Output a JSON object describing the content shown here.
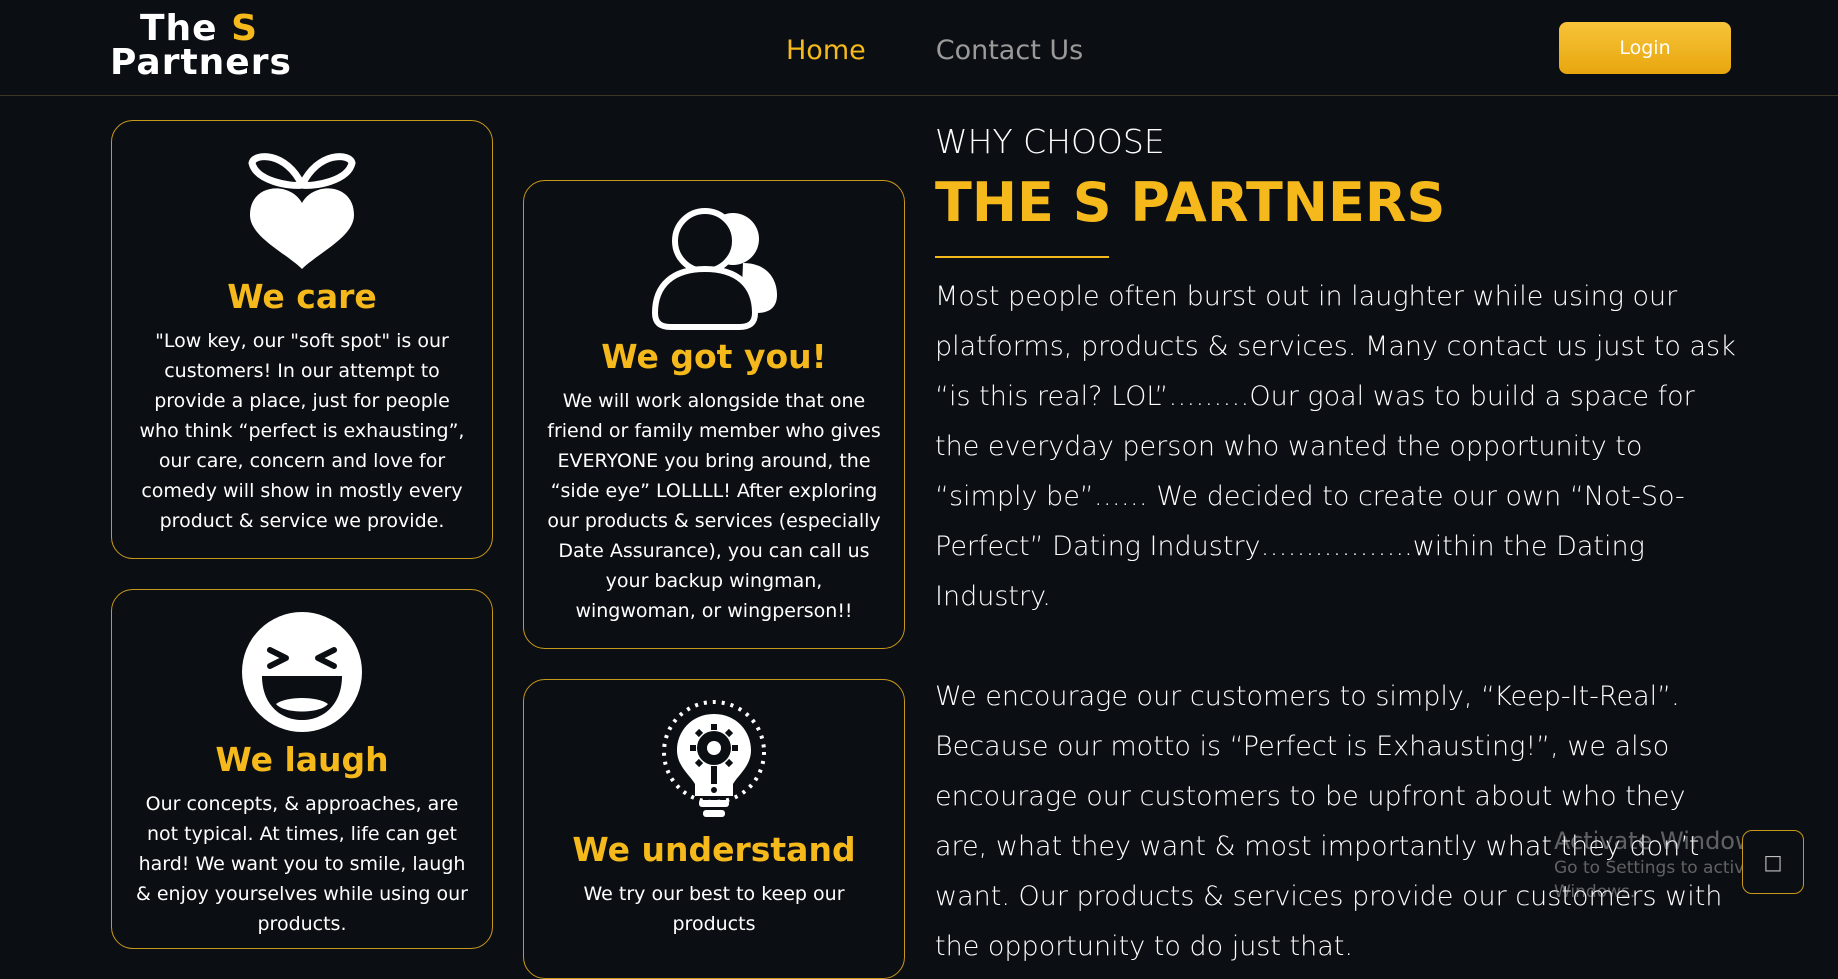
{
  "header": {
    "logo_line1_a": "The",
    "logo_line1_b": "S",
    "logo_line2": "Partners",
    "nav": [
      {
        "label": "Home",
        "active": true
      },
      {
        "label": "Contact Us",
        "active": false
      }
    ],
    "login_label": "Login"
  },
  "cards": {
    "care": {
      "icon": "heart-sprout-icon",
      "title": "We care",
      "text": "\"Low key, our \"soft spot\" is our customers! In our attempt to provide a place, just for people who think “perfect is exhausting”, our care, concern and love for comedy will show in mostly every product & service we provide."
    },
    "got": {
      "icon": "users-icon",
      "title": "We got you!",
      "text": "We will work alongside that one friend or family member who gives EVERYONE you bring around, the “side eye” LOLLLL! After exploring our products & services (especially Date Assurance), you can call us your backup wingman, wingwoman, or wingperson!!"
    },
    "laugh": {
      "icon": "laughing-face-icon",
      "title": "We laugh",
      "text": "Our concepts, & approaches, are not typical. At times, life can get hard! We want you to smile, laugh & enjoy yourselves while using our products."
    },
    "under": {
      "icon": "lightbulb-gear-icon",
      "title": "We understand",
      "text": "We try our best to keep our products"
    }
  },
  "why": {
    "eyebrow": "WHY CHOOSE",
    "title": "THE S PARTNERS",
    "para1": "Most people often burst out in laughter while using our platforms, products & services. Many contact us just to ask “is this real? LOL”………Our goal was to build a space for the everyday person who wanted the opportunity to “simply be”…… We decided to create our own “Not-So-Perfect” Dating Industry……………..within the Dating Industry.",
    "para2": "We encourage our customers to simply, “Keep-It-Real”. Because our motto is “Perfect is Exhausting!”, we also encourage our customers to be upfront about who they are, what they want & most importantly what they don’t want. Our products & services provide our customers with the opportunity to do just that."
  },
  "watermark": {
    "line1": "Activate Windows",
    "line2": "Go to Settings to activate Windows."
  },
  "colors": {
    "accent": "#f5b91b",
    "background": "#0b0e13",
    "border": "#c8981a"
  }
}
